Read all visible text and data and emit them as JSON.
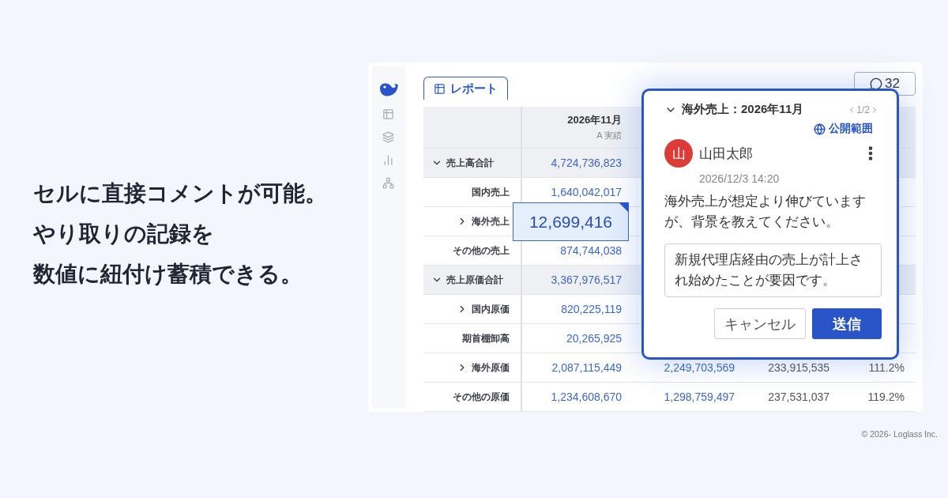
{
  "headline": [
    "セルに直接コメントが可能。",
    "やり取りの記録を",
    "数値に紐付け蓄積できる。"
  ],
  "report_tab": {
    "label": "レポート",
    "selected": true
  },
  "comment_count": "32",
  "table": {
    "columns": [
      {
        "period": "2026年11月",
        "scenario": "A 実績"
      }
    ],
    "rows": [
      {
        "label": "売上高合計",
        "kind": "group",
        "expanded": true,
        "values": [
          "4,724,736,823"
        ]
      },
      {
        "label": "国内売上",
        "kind": "leaf",
        "values": [
          "1,640,042,017"
        ]
      },
      {
        "label": "海外売上",
        "kind": "parent",
        "expanded": false,
        "selected": true,
        "values": [
          "12,699,416"
        ]
      },
      {
        "label": "その他の売上",
        "kind": "leaf",
        "values": [
          "874,744,038"
        ]
      },
      {
        "label": "売上原価合計",
        "kind": "group",
        "expanded": true,
        "values": [
          "3,367,976,517"
        ]
      },
      {
        "label": "国内原価",
        "kind": "parent",
        "expanded": false,
        "values": [
          "820,225,119"
        ]
      },
      {
        "label": "期首棚卸高",
        "kind": "leaf",
        "values": [
          "20,265,925"
        ]
      },
      {
        "label": "海外原価",
        "kind": "parent",
        "expanded": false,
        "values": [
          "2,087,115,449",
          "2,249,703,569",
          "233,915,535",
          "111.2%"
        ]
      },
      {
        "label": "その他の原価",
        "kind": "leaf",
        "values": [
          "1,234,608,670",
          "1,298,759,497",
          "237,531,037",
          "119.2%"
        ]
      }
    ]
  },
  "popover": {
    "title": "海外売上：2026年11月",
    "expanded": true,
    "pager": "1/2",
    "visibility": "公開範囲",
    "comment": {
      "avatar": "山",
      "author": "山田太郎",
      "time": "2026/12/3 14:20",
      "text": "海外売上が想定より伸びていますが、背景を教えてください。"
    },
    "reply": {
      "value": "新規代理店経由の売上が計上され始めたことが要因です。"
    },
    "buttons": [
      {
        "label": "キャンセル",
        "kind": "secondary"
      },
      {
        "label": "送信",
        "kind": "primary"
      }
    ]
  },
  "footer": "© 2026- Loglass Inc."
}
